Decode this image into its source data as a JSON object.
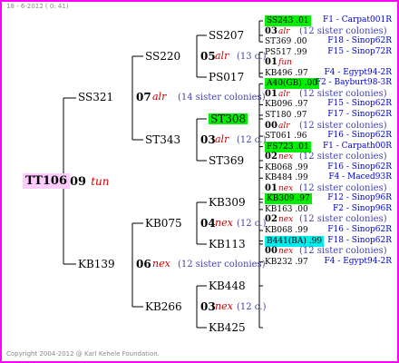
{
  "header": "18 - 6-2012 ( 0: 41)",
  "footer": "Copyright 2004-2012 @ Karl Kehele Foundation.",
  "root": {
    "id": "TT106",
    "num": "09",
    "year": "tun"
  },
  "parents": [
    {
      "id": "SS321",
      "num": "07",
      "year": "alr",
      "sisters": "(14 sister colonies)"
    },
    {
      "id": "KB139",
      "num": "06",
      "year": "nex",
      "sisters": "(12 sister colonies)"
    }
  ],
  "grandparents": [
    {
      "id": "SS220",
      "num": "05",
      "year": "alr",
      "sisters": "(13 c.)"
    },
    {
      "id": "ST343",
      "num": "03",
      "year": "alr",
      "sisters": "(12 c.)"
    },
    {
      "id": "KB075",
      "num": "04",
      "year": "nex",
      "sisters": "(12 c.)"
    },
    {
      "id": "KB266",
      "num": "03",
      "year": "nex",
      "sisters": "(12 c.)"
    }
  ],
  "ggp": [
    {
      "id": "SS207",
      "hl": ""
    },
    {
      "id": "PS017",
      "hl": ""
    },
    {
      "id": "ST308",
      "hl": "green"
    },
    {
      "id": "ST369",
      "hl": ""
    },
    {
      "id": "KB309",
      "hl": ""
    },
    {
      "id": "KB113",
      "hl": ""
    },
    {
      "id": "KB448",
      "hl": ""
    },
    {
      "id": "KB425",
      "hl": ""
    }
  ],
  "leaves": [
    {
      "type": "leaf",
      "text": "SS243 .01",
      "hl": "green",
      "origin": "F1 - Carpat001R"
    },
    {
      "type": "pre",
      "num": "03",
      "year": "alr",
      "sis": "(12 sister colonies)"
    },
    {
      "type": "leaf",
      "text": "ST369 .00",
      "hl": "",
      "origin": "F18 - Sinop62R"
    },
    {
      "type": "leaf",
      "text": "PS517 .99",
      "hl": "",
      "origin": "F15 - Sinop72R"
    },
    {
      "type": "pre",
      "num": "01",
      "year": "fun",
      "sis": ""
    },
    {
      "type": "leaf",
      "text": "KB496 .97",
      "hl": "",
      "origin": "F4 - Egypt94-2R"
    },
    {
      "type": "leaf",
      "text": "A40(GB) .00",
      "hl": "green",
      "origin": "F2 - Bayburt98-3R"
    },
    {
      "type": "pre",
      "num": "01",
      "year": "alr",
      "sis": "(12 sister colonies)"
    },
    {
      "type": "leaf",
      "text": "KB096 .97",
      "hl": "",
      "origin": "F15 - Sinop62R"
    },
    {
      "type": "leaf",
      "text": "ST180 .97",
      "hl": "",
      "origin": "F17 - Sinop62R"
    },
    {
      "type": "pre",
      "num": "00",
      "year": "alr",
      "sis": "(12 sister colonies)"
    },
    {
      "type": "leaf",
      "text": "ST061 .96",
      "hl": "",
      "origin": "F16 - Sinop62R"
    },
    {
      "type": "leaf",
      "text": "FS723 .01",
      "hl": "green",
      "origin": "F1 - Carpath00R"
    },
    {
      "type": "pre",
      "num": "02",
      "year": "nex",
      "sis": "(12 sister colonies)"
    },
    {
      "type": "leaf",
      "text": "KB068 .99",
      "hl": "",
      "origin": "F16 - Sinop62R"
    },
    {
      "type": "leaf",
      "text": "KB484 .99",
      "hl": "",
      "origin": "F4 - Maced93R"
    },
    {
      "type": "pre",
      "num": "01",
      "year": "nex",
      "sis": "(12 sister colonies)"
    },
    {
      "type": "leaf",
      "text": "KB309 .97",
      "hl": "green",
      "origin": "F12 - Sinop96R"
    },
    {
      "type": "leaf",
      "text": "KB163 .00",
      "hl": "",
      "origin": "F2 - Sinop96R"
    },
    {
      "type": "pre",
      "num": "02",
      "year": "nex",
      "sis": "(12 sister colonies)"
    },
    {
      "type": "leaf",
      "text": "KB068 .99",
      "hl": "",
      "origin": "F16 - Sinop62R"
    },
    {
      "type": "leaf",
      "text": "B441(BA) .99",
      "hl": "cyan",
      "origin": "F18 - Sinop62R"
    },
    {
      "type": "pre",
      "num": "00",
      "year": "nex",
      "sis": "(12 sister colonies)"
    },
    {
      "type": "leaf",
      "text": "KB232 .97",
      "hl": "",
      "origin": "F4 - Egypt94-2R"
    }
  ]
}
